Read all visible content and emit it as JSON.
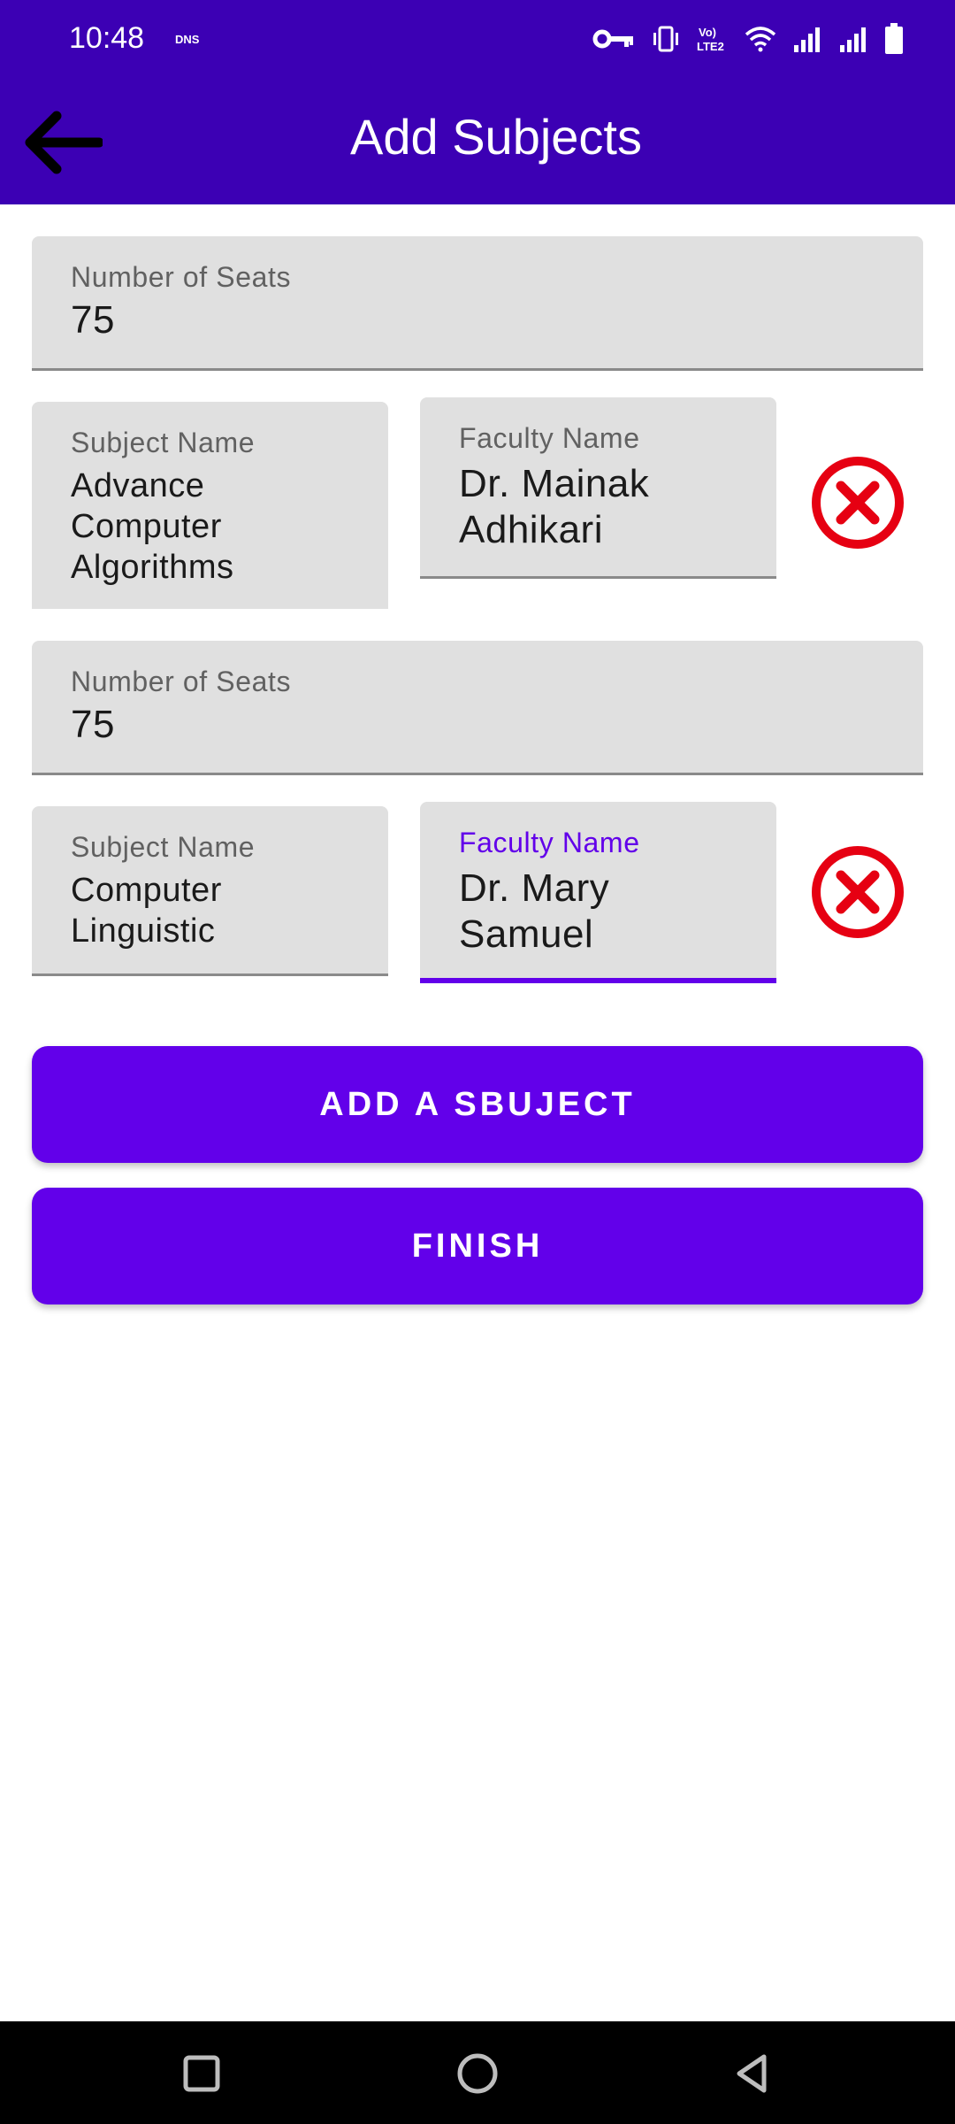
{
  "status_bar": {
    "time": "10:48",
    "dns_label": "DNS"
  },
  "app_bar": {
    "title": "Add Subjects",
    "back_icon": "arrow-left-icon"
  },
  "subjects": [
    {
      "seats_label": "Number of Seats",
      "seats_value": "75",
      "subject_label": "Subject Name",
      "subject_value": "Advance Computer Algorithms",
      "faculty_label": "Faculty Name",
      "faculty_value": "Dr. Mainak Adhikari",
      "faculty_focused": false
    },
    {
      "seats_label": "Number of Seats",
      "seats_value": "75",
      "subject_label": "Subject Name",
      "subject_value": "Computer Linguistic",
      "faculty_label": "Faculty Name",
      "faculty_value": "Dr. Mary Samuel",
      "faculty_focused": true
    }
  ],
  "actions": {
    "add_label": "ADD A SBUJECT",
    "finish_label": "FINISH"
  },
  "colors": {
    "app_bar": "#3c00b4",
    "primary": "#6200ea",
    "remove": "#e60012"
  }
}
